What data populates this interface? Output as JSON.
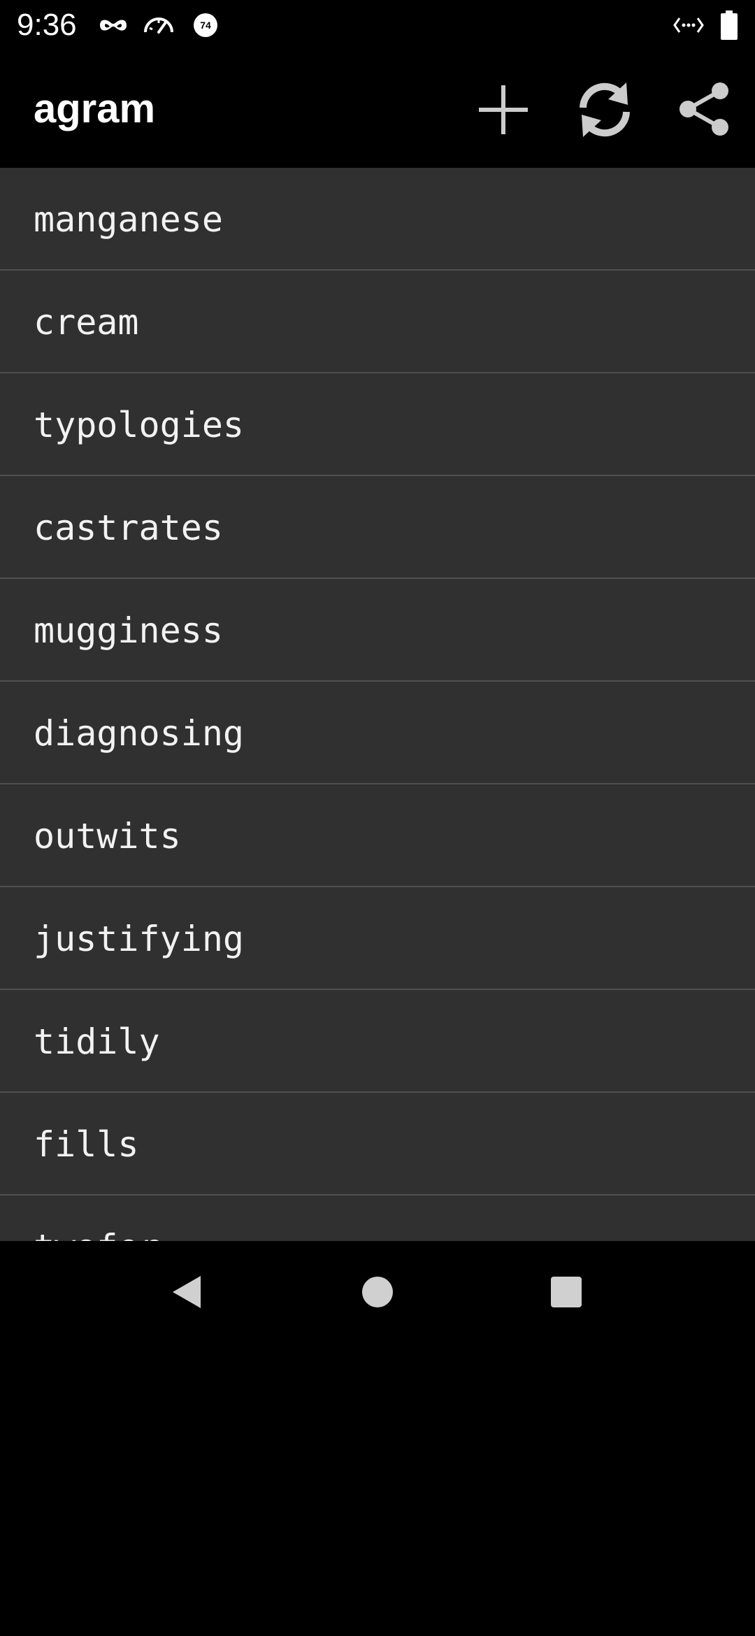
{
  "status_bar": {
    "time": "9:36",
    "battery_level": 1.0,
    "left_icons": [
      "incognito-icon",
      "speedometer-icon",
      "notification-count-icon"
    ],
    "notification_count": "74",
    "right_icons": [
      "data-saver-icon",
      "battery-icon"
    ]
  },
  "app_bar": {
    "title": "agram",
    "actions": [
      "add-icon",
      "refresh-icon",
      "share-icon"
    ]
  },
  "word_list": {
    "items": [
      {
        "word": "manganese"
      },
      {
        "word": "cream"
      },
      {
        "word": "typologies"
      },
      {
        "word": "castrates"
      },
      {
        "word": "mugginess"
      },
      {
        "word": "diagnosing"
      },
      {
        "word": "outwits"
      },
      {
        "word": "justifying"
      },
      {
        "word": "tidily"
      },
      {
        "word": "fills"
      },
      {
        "word": "twofer"
      }
    ]
  },
  "navigation_bar": {
    "buttons": [
      "back-icon",
      "home-icon",
      "recents-icon"
    ]
  },
  "colors": {
    "background": "#000000",
    "list_background": "#303030",
    "divider": "#505050",
    "text": "#f2f2f2",
    "icon": "#cccccc"
  }
}
